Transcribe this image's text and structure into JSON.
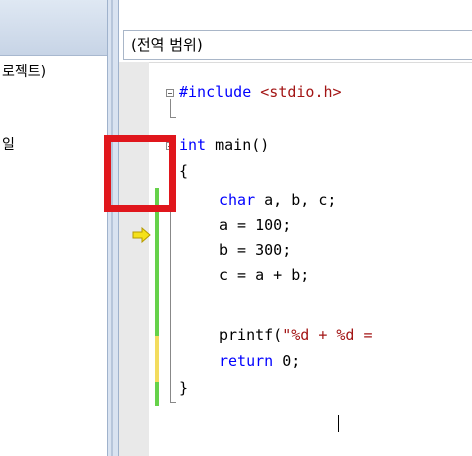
{
  "left_pane": {
    "project_label": "로젝트)",
    "item_label": "일"
  },
  "editor": {
    "scope_text": "(전역 범위)",
    "code_lines": {
      "l1_kw": "#include",
      "l1_rest": " <stdio.h>",
      "l2_kw": "int",
      "l2_rest": " main()",
      "l3": "{",
      "l4_kw": "char",
      "l4_rest": " a, b, c;",
      "l5": "a = 100;",
      "l6": "b = 300;",
      "l7": "c = a + b;",
      "l8_func": "printf(",
      "l8_str": "\"%d + %d =",
      "l9_kw": "return",
      "l9_rest": " 0;",
      "l10": "}"
    }
  },
  "icons": {
    "execution_arrow": "current-line-arrow-icon"
  },
  "colors": {
    "keyword": "#0000ff",
    "string": "#a31515",
    "highlight_box": "#e0161c",
    "change_saved": "#66d24a",
    "change_unsaved": "#f3dc5e",
    "arrow": "#f5e11a"
  }
}
